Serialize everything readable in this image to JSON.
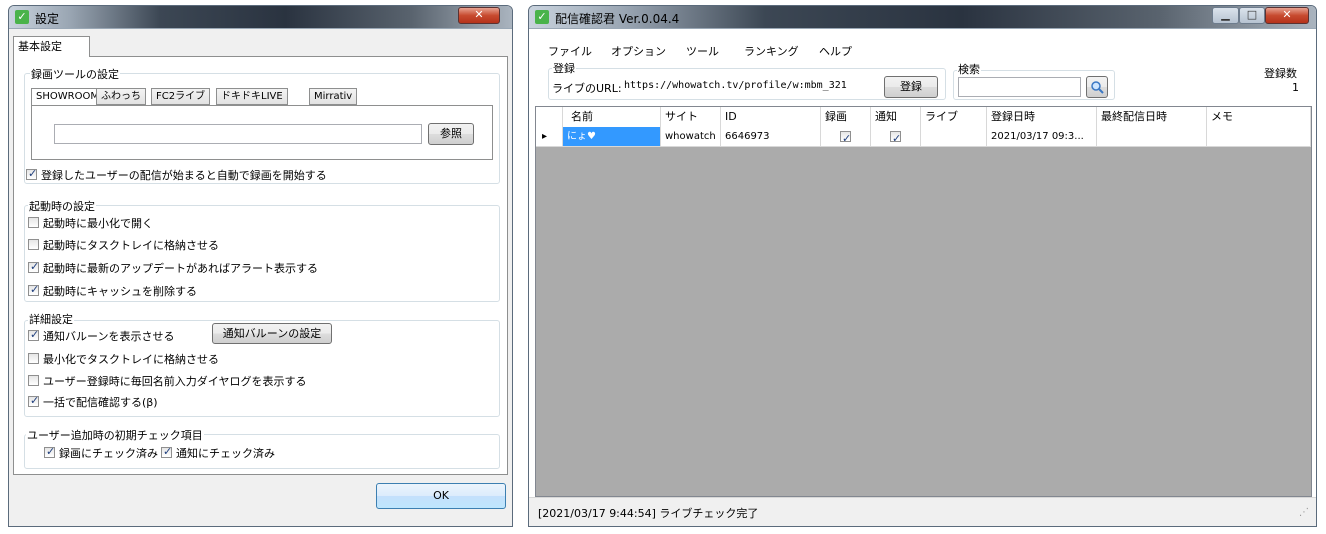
{
  "settings": {
    "title": "設定",
    "tab_basic": "基本設定",
    "rec_tool": {
      "label": "録画ツールの設定",
      "tabs": [
        "SHOWROOM",
        "ふわっち",
        "FC2ライブ",
        "ドキドキLIVE",
        "Mirrativ"
      ],
      "path_value": "",
      "browse": "参照",
      "auto_record": "登録したユーザーの配信が始まると自動で録画を開始する",
      "auto_record_checked": true
    },
    "startup": {
      "label": "起動時の設定",
      "items": [
        {
          "label": "起動時に最小化で開く",
          "checked": false
        },
        {
          "label": "起動時にタスクトレイに格納させる",
          "checked": false
        },
        {
          "label": "起動時に最新のアップデートがあればアラート表示する",
          "checked": true
        },
        {
          "label": "起動時にキャッシュを削除する",
          "checked": true
        }
      ]
    },
    "detail": {
      "label": "詳細設定",
      "balloon": "通知バルーンを表示させる",
      "balloon_checked": true,
      "balloon_settings": "通知バルーンの設定",
      "items": [
        {
          "label": "最小化でタスクトレイに格納させる",
          "checked": false
        },
        {
          "label": "ユーザー登録時に毎回名前入力ダイヤログを表示する",
          "checked": false
        },
        {
          "label": "一括で配信確認する(β)",
          "checked": true
        }
      ]
    },
    "initial": {
      "label": "ユーザー追加時の初期チェック項目",
      "rec": "録画にチェック済み",
      "rec_checked": true,
      "notify": "通知にチェック済み",
      "notify_checked": true
    },
    "ok": "OK"
  },
  "main": {
    "title": "配信確認君  Ver.0.04.4",
    "menu": [
      "ファイル",
      "オプション",
      "ツール",
      "ランキング",
      "ヘルプ"
    ],
    "register_label": "登録",
    "url_label": "ライブのURL:",
    "url_value": "https://whowatch.tv/profile/w:mbm_321",
    "register_button": "登録",
    "search_label": "検索",
    "search_value": "",
    "count_label": "登録数",
    "count_value": "1",
    "columns": [
      "名前",
      "サイト",
      "ID",
      "録画",
      "通知",
      "ライブ",
      "登録日時",
      "最終配信日時",
      "メモ"
    ],
    "rows": [
      {
        "name": "にょ♥",
        "site": "whowatch",
        "id": "6646973",
        "rec": true,
        "notify": true,
        "live": "",
        "registered": "2021/03/17 09:3...",
        "last": "",
        "memo": ""
      }
    ],
    "status": "[2021/03/17 9:44:54] ライブチェック完了"
  },
  "colors": {
    "selected_cell": "#3399ff",
    "grid_bg": "#ababab",
    "check_green": "#49b34a"
  }
}
